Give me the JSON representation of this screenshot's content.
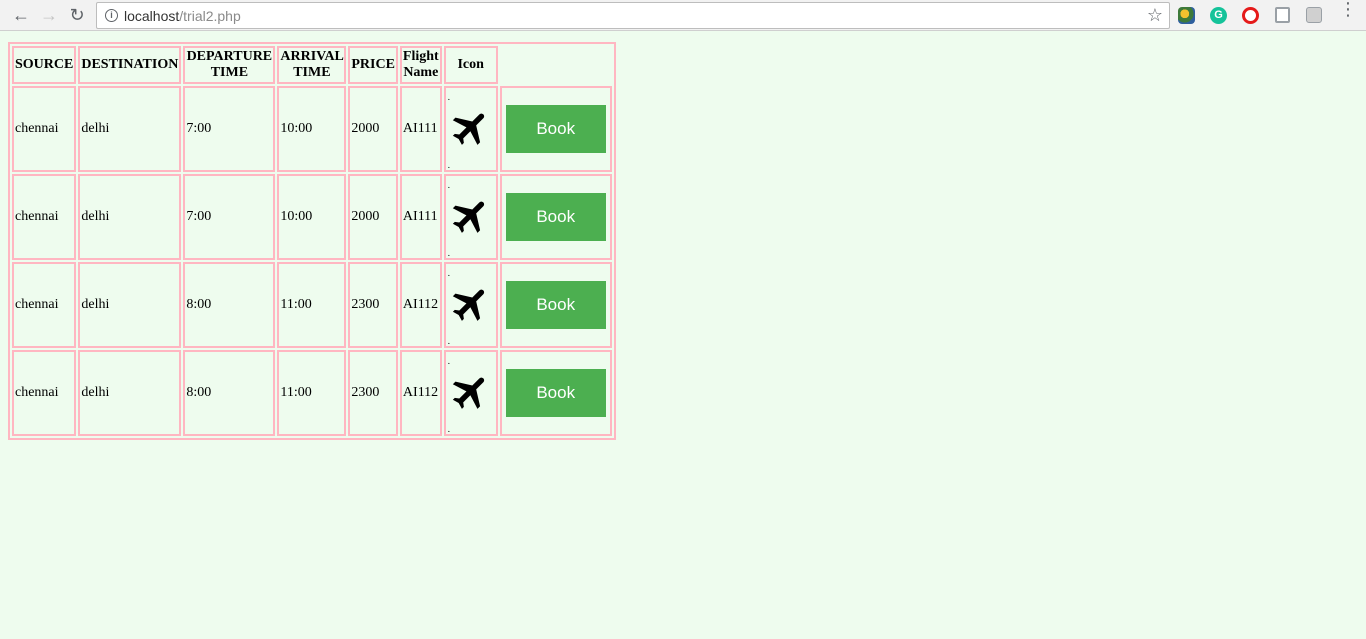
{
  "browser": {
    "url_host": "localhost",
    "url_path": "/trial2.php",
    "extensions": [
      "globe-extension-icon",
      "grammarly-icon",
      "opera-icon",
      "copy-icon",
      "box-icon"
    ]
  },
  "table": {
    "headers": [
      "SOURCE",
      "DESTINATION",
      "DEPARTURE TIME",
      "ARRIVAL TIME",
      "PRICE",
      "Flight Name",
      "Icon"
    ],
    "rows": [
      {
        "source": "chennai",
        "destination": "delhi",
        "departure": "7:00",
        "arrival": "10:00",
        "price": "2000",
        "flight": "AI111",
        "button": "Book"
      },
      {
        "source": "chennai",
        "destination": "delhi",
        "departure": "7:00",
        "arrival": "10:00",
        "price": "2000",
        "flight": "AI111",
        "button": "Book"
      },
      {
        "source": "chennai",
        "destination": "delhi",
        "departure": "8:00",
        "arrival": "11:00",
        "price": "2300",
        "flight": "AI112",
        "button": "Book"
      },
      {
        "source": "chennai",
        "destination": "delhi",
        "departure": "8:00",
        "arrival": "11:00",
        "price": "2300",
        "flight": "AI112",
        "button": "Book"
      }
    ],
    "border_color": "#ffb6c1",
    "button_color": "#4caf50",
    "row_icon": "airplane-icon"
  },
  "page": {
    "background": "#eefcee"
  }
}
